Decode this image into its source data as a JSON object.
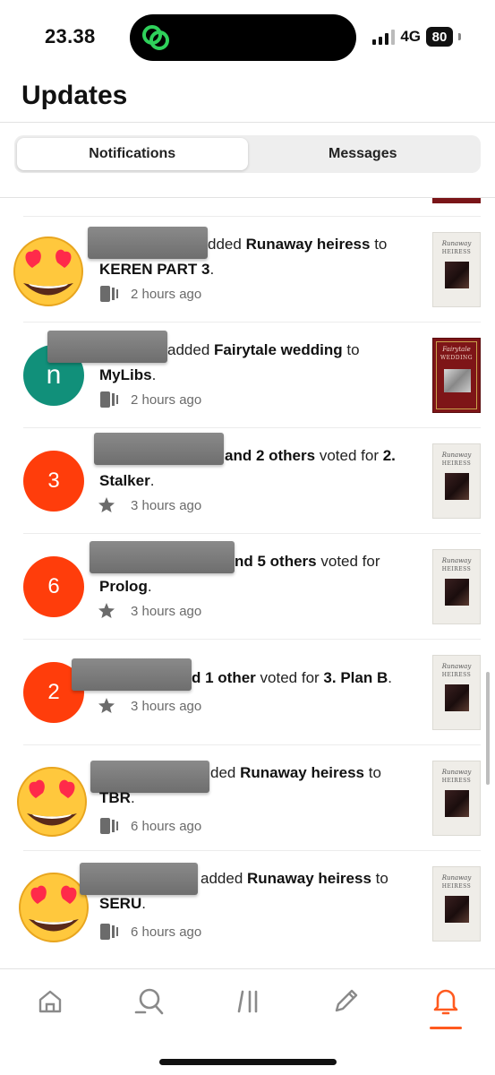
{
  "status_bar": {
    "time": "23.38",
    "network": "4G",
    "battery": "80"
  },
  "header": {
    "title": "Updates"
  },
  "tabs": [
    {
      "label": "Notifications",
      "active": true
    },
    {
      "label": "Messages",
      "active": false
    }
  ],
  "notifications": [
    {
      "avatar_type": "emoji",
      "avatar_icon": "heart-eyes-emoji",
      "action_text": "dded",
      "item": "Runaway heiress",
      "connector": "to",
      "target": "KEREN PART 3",
      "trailing": ".",
      "meta_icon": "reading-list-icon",
      "time": "2 hours ago",
      "cover": "Runaway Heiress"
    },
    {
      "avatar_type": "letter",
      "avatar_letter": "n",
      "action_text": "added",
      "item": "Fairytale wedding",
      "connector": "to",
      "target": "MyLibs",
      "trailing": ".",
      "meta_icon": "reading-list-icon",
      "time": "2 hours ago",
      "cover": "Fairytale Wedding"
    },
    {
      "avatar_type": "count",
      "avatar_letter": "3",
      "others": "and 2 others",
      "action_text": "voted for",
      "target": "2. Stalker",
      "trailing": ".",
      "meta_icon": "star-icon",
      "time": "3 hours ago",
      "cover": "Runaway Heiress"
    },
    {
      "avatar_type": "count",
      "avatar_letter": "6",
      "others": "nd 5 others",
      "action_text": "voted for",
      "target": "Prolog",
      "trailing": ".",
      "meta_icon": "star-icon",
      "time": "3 hours ago",
      "cover": "Runaway Heiress"
    },
    {
      "avatar_type": "count",
      "avatar_letter": "2",
      "others": "d 1 other",
      "action_text": "voted for",
      "target": "3. Plan B",
      "trailing": ".",
      "meta_icon": "star-icon",
      "time": "3 hours ago",
      "cover": "Runaway Heiress"
    },
    {
      "avatar_type": "emoji",
      "avatar_icon": "heart-eyes-emoji",
      "action_text": "ded",
      "item": "Runaway heiress",
      "connector": "to",
      "target": "TBR",
      "trailing": ".",
      "meta_icon": "reading-list-icon",
      "time": "6 hours ago",
      "cover": "Runaway Heiress"
    },
    {
      "avatar_type": "emoji",
      "avatar_icon": "heart-eyes-emoji",
      "action_text": "added",
      "item": "Runaway heiress",
      "connector": "to",
      "target": "SERU",
      "trailing": ".",
      "meta_icon": "reading-list-icon",
      "time": "6 hours ago",
      "cover": "Runaway Heiress"
    }
  ],
  "covers": {
    "runaway": {
      "line1": "Runaway",
      "line2": "HEIRESS"
    },
    "fairytale": {
      "line1": "Fairytale",
      "line2": "WEDDING"
    }
  },
  "bottom_nav": [
    {
      "icon": "home-icon",
      "active": false
    },
    {
      "icon": "search-icon",
      "active": false
    },
    {
      "icon": "library-icon",
      "active": false
    },
    {
      "icon": "write-icon",
      "active": false
    },
    {
      "icon": "bell-icon",
      "active": true
    }
  ],
  "colors": {
    "accent": "#ff5a1f",
    "count_avatar": "#ff3d0b",
    "teal_avatar": "#11907a"
  }
}
